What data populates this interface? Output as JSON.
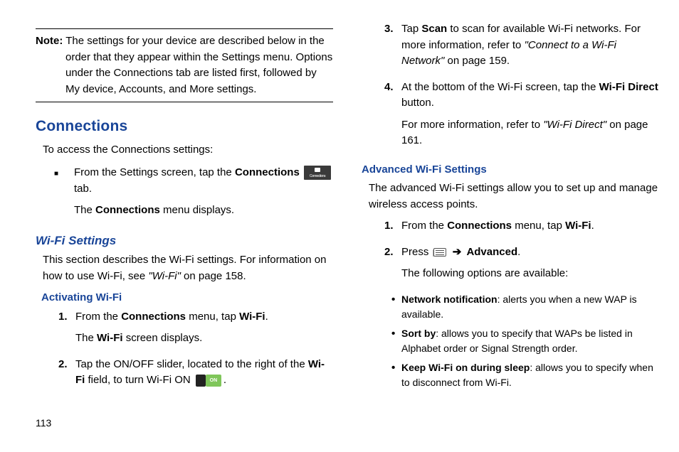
{
  "pageNumber": "113",
  "note": {
    "label": "Note:",
    "text": "The settings for your device are described below in the order that they appear within the Settings menu. Options under the Connections tab are listed first, followed by My device, Accounts, and More settings."
  },
  "section": {
    "title": "Connections",
    "intro": "To access the Connections settings:",
    "bullet": {
      "p1_a": "From the Settings screen, tap the ",
      "p1_b": "Connections",
      "p1_c": " tab.",
      "p2_a": "The ",
      "p2_b": "Connections",
      "p2_c": " menu displays."
    }
  },
  "wifi": {
    "title": "Wi-Fi Settings",
    "body_a": "This section describes the Wi-Fi settings. For information on how to use Wi-Fi, see ",
    "body_b": "\"Wi-Fi\"",
    "body_c": " on page 158.",
    "activating": {
      "title": "Activating Wi-Fi",
      "s1_a": "From the ",
      "s1_b": "Connections",
      "s1_c": " menu, tap ",
      "s1_d": "Wi-Fi",
      "s1_e": ".",
      "s1f_a": "The ",
      "s1f_b": "Wi-Fi",
      "s1f_c": " screen displays.",
      "s2_a": "Tap the ON/OFF slider, located to the right of the ",
      "s2_b": "Wi-Fi",
      "s2_c": " field, to turn Wi-Fi ON ",
      "s2_d": "."
    }
  },
  "right": {
    "s3_a": "Tap ",
    "s3_b": "Scan",
    "s3_c": " to scan for available Wi-Fi networks. For more information, refer to ",
    "s3_d": "\"Connect to a Wi-Fi Network\" ",
    "s3_e": " on page 159.",
    "s4_a": "At the bottom of the Wi-Fi screen, tap the ",
    "s4_b": "Wi-Fi Direct",
    "s4_c": " button.",
    "s4f_a": "For more information, refer to ",
    "s4f_b": "\"Wi-Fi Direct\" ",
    "s4f_c": " on page 161."
  },
  "advanced": {
    "title": "Advanced Wi-Fi Settings",
    "intro": "The advanced Wi-Fi settings allow you to set up and manage wireless access points.",
    "s1_a": "From the ",
    "s1_b": "Connections",
    "s1_c": " menu, tap ",
    "s1_d": "Wi-Fi",
    "s1_e": ".",
    "s2_a": "Press ",
    "s2_b": "Advanced",
    "s2_c": ".",
    "s2f": "The following options are available:",
    "b1_a": "Network notification",
    "b1_b": ": alerts you when a new WAP is available.",
    "b2_a": "Sort by",
    "b2_b": ": allows you to specify that WAPs be listed in Alphabet order or Signal Strength order.",
    "b3_a": "Keep Wi-Fi on during sleep",
    "b3_b": ": allows you to specify when to disconnect from Wi-Fi."
  },
  "nums": {
    "n1": "1.",
    "n2": "2.",
    "n3": "3.",
    "n4": "4."
  },
  "arrow": "➔"
}
